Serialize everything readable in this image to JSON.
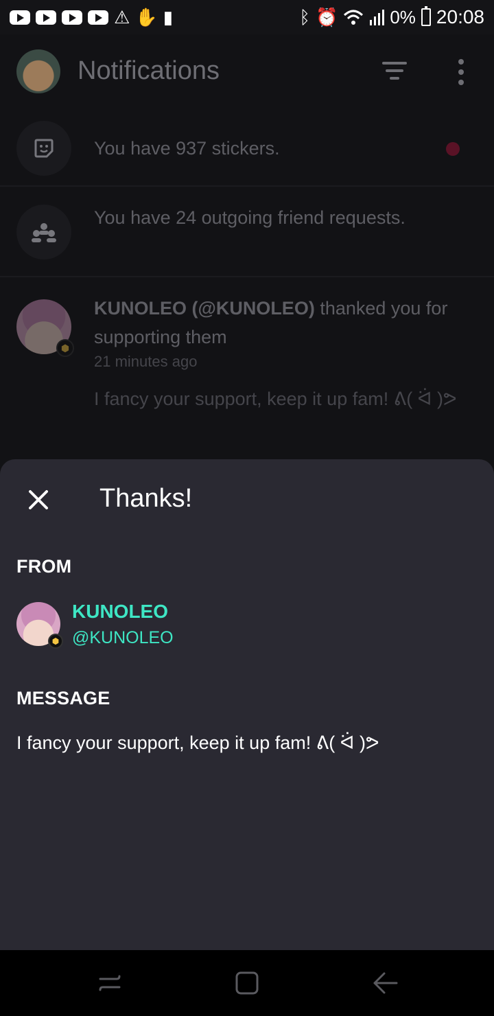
{
  "status_bar": {
    "battery": "0%",
    "time": "20:08"
  },
  "app_bar": {
    "title": "Notifications"
  },
  "notifications": [
    {
      "text": "You have 937 stickers.",
      "icon": "sticker-icon",
      "unread": true
    },
    {
      "text": "You have 24 outgoing friend requests.",
      "icon": "friends-icon"
    },
    {
      "name": "KUNOLEO (@KUNOLEO)",
      "action": " thanked you for supporting them",
      "time": "21 minutes ago",
      "message": "I fancy your support, keep it up fam! ᕕ( ᐛ )ᕗ"
    }
  ],
  "sheet": {
    "title": "Thanks!",
    "from_label": "FROM",
    "from_name": "KUNOLEO",
    "from_handle": "@KUNOLEO",
    "message_label": "MESSAGE",
    "message": "I fancy your support, keep it up fam! ᕕ( ᐛ )ᕗ"
  },
  "colors": {
    "accent": "#3ee6c4",
    "sheet_bg": "#2a2932",
    "unread_dot": "#5a1226"
  }
}
